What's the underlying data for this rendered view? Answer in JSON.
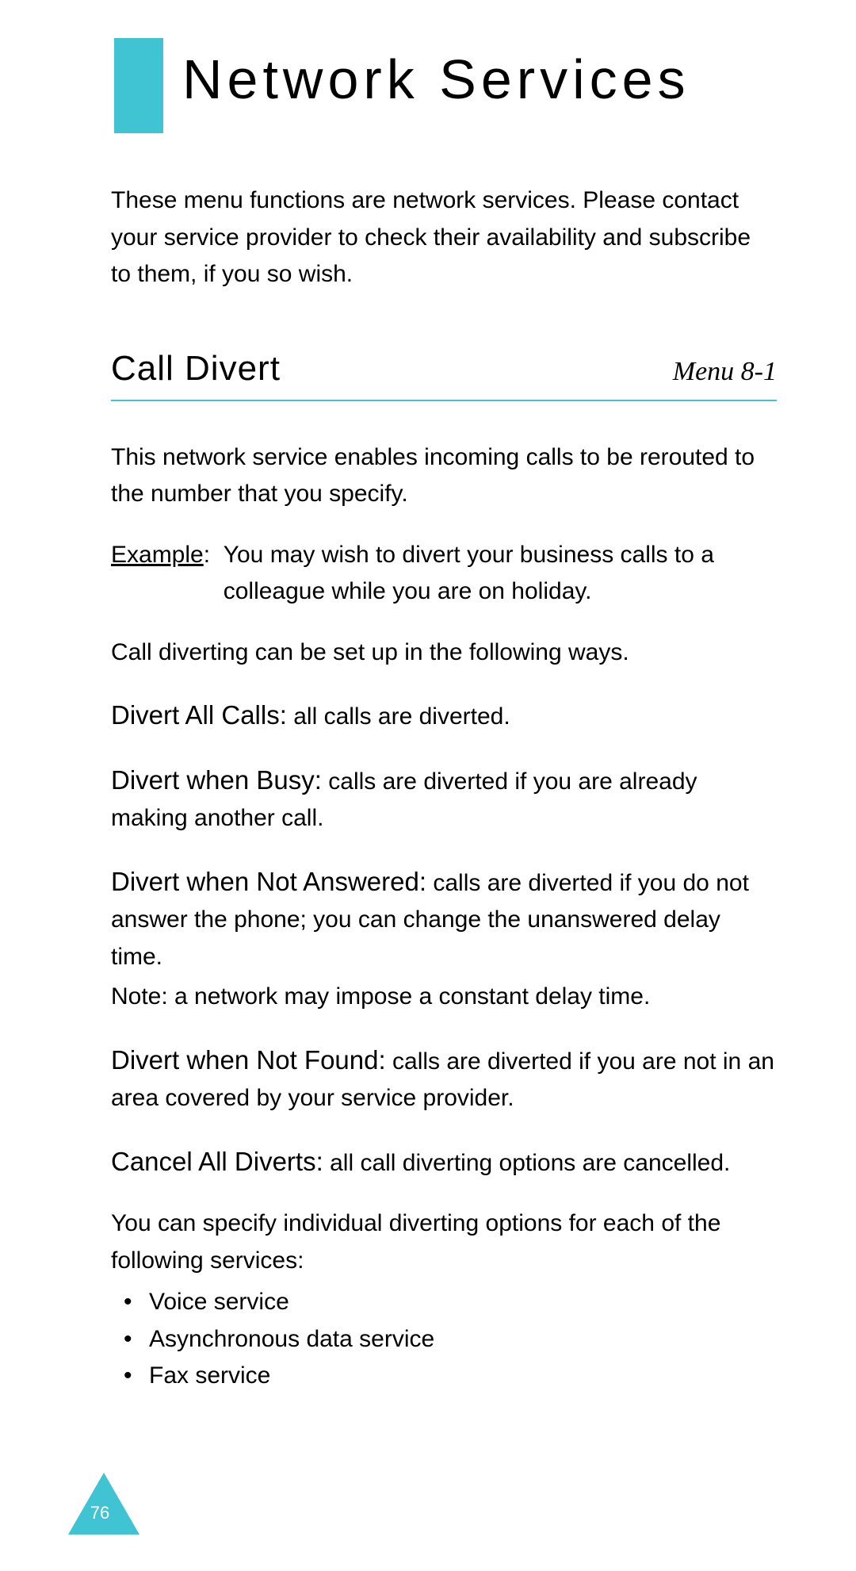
{
  "title": "Network Services",
  "intro": "These menu functions are network services. Please contact your service provider to check their availability and subscribe to them, if you so wish.",
  "section": {
    "title": "Call Divert",
    "menu_ref": "Menu 8-1",
    "description": "This network service enables incoming calls to be rerouted to the number that you specify.",
    "example_label": "Example",
    "example_text": "You may wish to divert your business calls to a colleague while you are on holiday.",
    "setup_intro": "Call diverting can be set up in the following ways.",
    "options": [
      {
        "title": "Divert All Calls:",
        "desc": " all calls are diverted."
      },
      {
        "title": "Divert when Busy:",
        "desc": " calls are diverted if you are already making another call."
      },
      {
        "title": "Divert when Not Answered:",
        "desc": " calls are diverted if you do not answer the phone; you can change the unanswered delay time.",
        "note": "Note: a network may impose a constant delay time."
      },
      {
        "title": "Divert when Not Found:",
        "desc": " calls are diverted if you are not in an area covered by your service provider."
      },
      {
        "title": "Cancel All Diverts:",
        "desc": " all call diverting options are cancelled."
      }
    ],
    "services_intro": "You can specify individual diverting options for each of the following services:",
    "services": [
      "Voice service",
      "Asynchronous data service",
      "Fax service"
    ]
  },
  "page_number": "76"
}
